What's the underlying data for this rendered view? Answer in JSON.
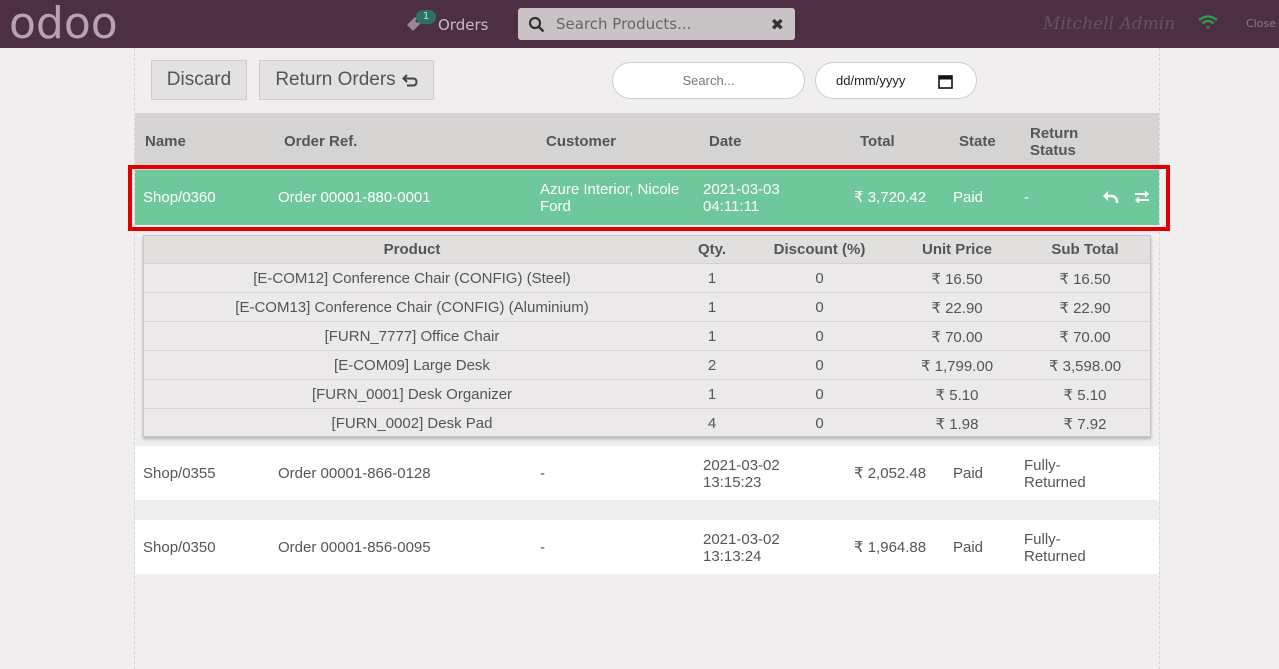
{
  "topbar": {
    "logo_text": "odoo",
    "orders_label": "Orders",
    "orders_badge": "1",
    "search_placeholder": "Search Products...",
    "user_name": "Mitchell Admin",
    "close_label": "Close"
  },
  "toolbar": {
    "discard_label": "Discard",
    "return_orders_label": "Return Orders",
    "search_placeholder": "Search...",
    "date_placeholder": "dd/mm/yyyy"
  },
  "table": {
    "headers": {
      "name": "Name",
      "order_ref": "Order Ref.",
      "customer": "Customer",
      "date": "Date",
      "total": "Total",
      "state": "State",
      "return_status_1": "Return",
      "return_status_2": "Status"
    },
    "orders": [
      {
        "name": "Shop/0360",
        "order_ref": "Order 00001-880-0001",
        "customer_1": "Azure Interior, Nicole",
        "customer_2": "Ford",
        "date_1": "2021-03-03",
        "date_2": "04:11:11",
        "total": "₹ 3,720.42",
        "state": "Paid",
        "return_status_1": "-",
        "return_status_2": ""
      },
      {
        "name": "Shop/0355",
        "order_ref": "Order 00001-866-0128",
        "customer_1": "-",
        "customer_2": "",
        "date_1": "2021-03-02",
        "date_2": "13:15:23",
        "total": "₹ 2,052.48",
        "state": "Paid",
        "return_status_1": "Fully-",
        "return_status_2": "Returned"
      },
      {
        "name": "Shop/0350",
        "order_ref": "Order 00001-856-0095",
        "customer_1": "-",
        "customer_2": "",
        "date_1": "2021-03-02",
        "date_2": "13:13:24",
        "total": "₹ 1,964.88",
        "state": "Paid",
        "return_status_1": "Fully-",
        "return_status_2": "Returned"
      }
    ]
  },
  "details": {
    "headers": {
      "product": "Product",
      "qty": "Qty.",
      "discount": "Discount (%)",
      "unit_price": "Unit Price",
      "sub_total": "Sub Total"
    },
    "lines": [
      {
        "product": "[E-COM12] Conference Chair (CONFIG) (Steel)",
        "qty": "1",
        "discount": "0",
        "unit_price": "₹ 16.50",
        "sub_total": "₹ 16.50"
      },
      {
        "product": "[E-COM13] Conference Chair (CONFIG) (Aluminium)",
        "qty": "1",
        "discount": "0",
        "unit_price": "₹ 22.90",
        "sub_total": "₹ 22.90"
      },
      {
        "product": "[FURN_7777] Office Chair",
        "qty": "1",
        "discount": "0",
        "unit_price": "₹ 70.00",
        "sub_total": "₹ 70.00"
      },
      {
        "product": "[E-COM09] Large Desk",
        "qty": "2",
        "discount": "0",
        "unit_price": "₹ 1,799.00",
        "sub_total": "₹ 3,598.00"
      },
      {
        "product": "[FURN_0001] Desk Organizer",
        "qty": "1",
        "discount": "0",
        "unit_price": "₹ 5.10",
        "sub_total": "₹ 5.10"
      },
      {
        "product": "[FURN_0002] Desk Pad",
        "qty": "4",
        "discount": "0",
        "unit_price": "₹ 1.98",
        "sub_total": "₹ 7.92"
      }
    ]
  },
  "colors": {
    "topbar": "#4c2e45",
    "selected_row": "#6ec89b",
    "highlight": "#e00000"
  }
}
